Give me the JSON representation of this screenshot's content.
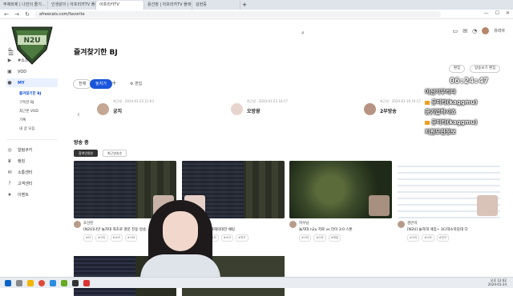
{
  "browser": {
    "tabs": [
      {
        "label": "주제와제 | 나만의 즐기…"
      },
      {
        "label": "인생같이 | 아프리카TV 플레이어"
      },
      {
        "label": "아프리카TV"
      },
      {
        "label": "용선정 | 아프리카TV 플레이어"
      },
      {
        "label": "김현중"
      }
    ],
    "url": "afreecatv.com/favorite"
  },
  "sidebar": {
    "items": [
      {
        "label": "홈",
        "icon": "home-icon"
      },
      {
        "label": "#쇼츠",
        "icon": "shorts-icon"
      },
      {
        "label": "VOD",
        "icon": "vod-icon"
      },
      {
        "label": "MY",
        "icon": "my-icon"
      }
    ],
    "sub_items": [
      {
        "label": "즐겨찾기한 BJ"
      },
      {
        "label": "구독한 BJ"
      },
      {
        "label": "최근본 VOD"
      },
      {
        "label": "기록"
      },
      {
        "label": "내 글 모음"
      }
    ],
    "bottom_items": [
      {
        "label": "알림쿠키",
        "icon": "cookie-icon"
      },
      {
        "label": "랭킹",
        "icon": "ranking-icon"
      },
      {
        "label": "소통센터",
        "icon": "community-icon"
      },
      {
        "label": "고객센터",
        "icon": "support-icon"
      },
      {
        "label": "이벤트",
        "icon": "event-icon"
      }
    ]
  },
  "header": {
    "username": "유리아"
  },
  "page": {
    "title": "즐겨찾기한 BJ",
    "top_buttons": [
      "편집",
      "방송보기 편집"
    ],
    "filters": [
      "전체",
      "놓치기"
    ],
    "edit_label": "편집",
    "favorites": [
      {
        "time": "최근방 · 2024-01-23 21:03",
        "name": "궁지"
      },
      {
        "time": "최근방 · 2024-01-23 10:17",
        "name": "오방광"
      },
      {
        "time": "최근방 · 2024-01-19 10:17",
        "name": "2부방송"
      }
    ],
    "section_title": "방송 중",
    "sort_buttons": [
      "참여인원순",
      "최근방송순"
    ]
  },
  "streams": [
    {
      "bj": "호선된",
      "title": "[N2U]나만 놀자대 최초로 명문 진동 방송...",
      "tags": [
        "#다",
        "#스타",
        "#소크",
        "#스타"
      ]
    },
    {
      "bj": "방송하니",
      "title": "놀자대 방송 대해의대한 채팅",
      "tags": [
        "#스타",
        "#놀자",
        "#소크",
        "#지구"
      ]
    },
    {
      "bj": "지우님",
      "title": "놀자대 n2u 저로 vs 라이 3:0 스톤",
      "tags": [
        "#스타",
        "#스타",
        "#게임"
      ]
    },
    {
      "bj": "경은미",
      "title": "[N2U] 놀자대 게임~ 3C/대소북당대 다",
      "tags": [
        "#스타",
        "#스타",
        "#지구"
      ]
    }
  ],
  "overlay": {
    "clock": "06:24:47",
    "chat": [
      {
        "text": "이신기무리다",
        "badge": false
      },
      {
        "text": "규미타(kaggmu)",
        "badge": true
      },
      {
        "text": "콩기업하시죠",
        "badge": false
      },
      {
        "text": "규미타(kaggmu)",
        "badge": true
      },
      {
        "text": "지원도전정보",
        "badge": false
      }
    ]
  },
  "taskbar": {
    "time": "오후 12:42",
    "date": "2024-01-24"
  }
}
